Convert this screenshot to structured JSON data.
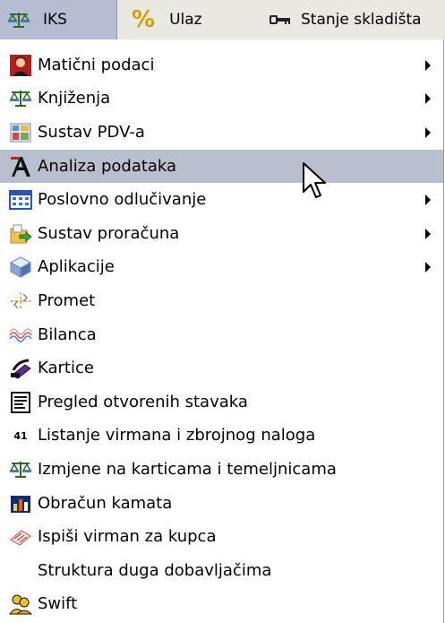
{
  "menubar": {
    "iks": "IKS",
    "ulaz_symbol": "%",
    "ulaz": "Ulaz",
    "stanje": "Stanje skladišta"
  },
  "menu": {
    "items": [
      {
        "label": "Matični podaci",
        "icon": "person-photo-icon",
        "submenu": true
      },
      {
        "label": "Knjiženja",
        "icon": "balance-scale-icon",
        "submenu": true
      },
      {
        "label": "Sustav PDV-a",
        "icon": "grid-document-icon",
        "submenu": true
      },
      {
        "label": "Analiza podataka",
        "icon": "letter-a-icon",
        "submenu": false,
        "highlighted": true
      },
      {
        "label": "Poslovno odlučivanje",
        "icon": "calendar-grid-icon",
        "submenu": true
      },
      {
        "label": "Sustav proračuna",
        "icon": "folder-arrow-icon",
        "submenu": true
      },
      {
        "label": "Aplikacije",
        "icon": "cube-icon",
        "submenu": true
      },
      {
        "label": "Promet",
        "icon": "transfer-icon",
        "submenu": false
      },
      {
        "label": "Bilanca",
        "icon": "wave-lines-icon",
        "submenu": false
      },
      {
        "label": "Kartice",
        "icon": "card-swipe-icon",
        "submenu": false
      },
      {
        "label": "Pregled otvorenih stavaka",
        "icon": "list-document-icon",
        "submenu": false
      },
      {
        "label": "Listanje virmana i zbrojnog naloga",
        "icon": "number-icon",
        "icon_text": "41",
        "submenu": false
      },
      {
        "label": "Izmjene na karticama i temeljnicama",
        "icon": "balance-scale-icon",
        "submenu": false
      },
      {
        "label": "Obračun kamata",
        "icon": "bar-chart-icon",
        "submenu": false
      },
      {
        "label": "Ispiši virman za kupca",
        "icon": "printer-slip-icon",
        "submenu": false
      },
      {
        "label": "Struktura duga dobavljačima",
        "icon": "",
        "submenu": false
      },
      {
        "label": "Swift",
        "icon": "people-icon",
        "submenu": false
      }
    ]
  },
  "colors": {
    "menubar_bg": "#e9e8e3",
    "highlight": "#b8bfcf",
    "active_menubar": "#b6bdd2"
  }
}
